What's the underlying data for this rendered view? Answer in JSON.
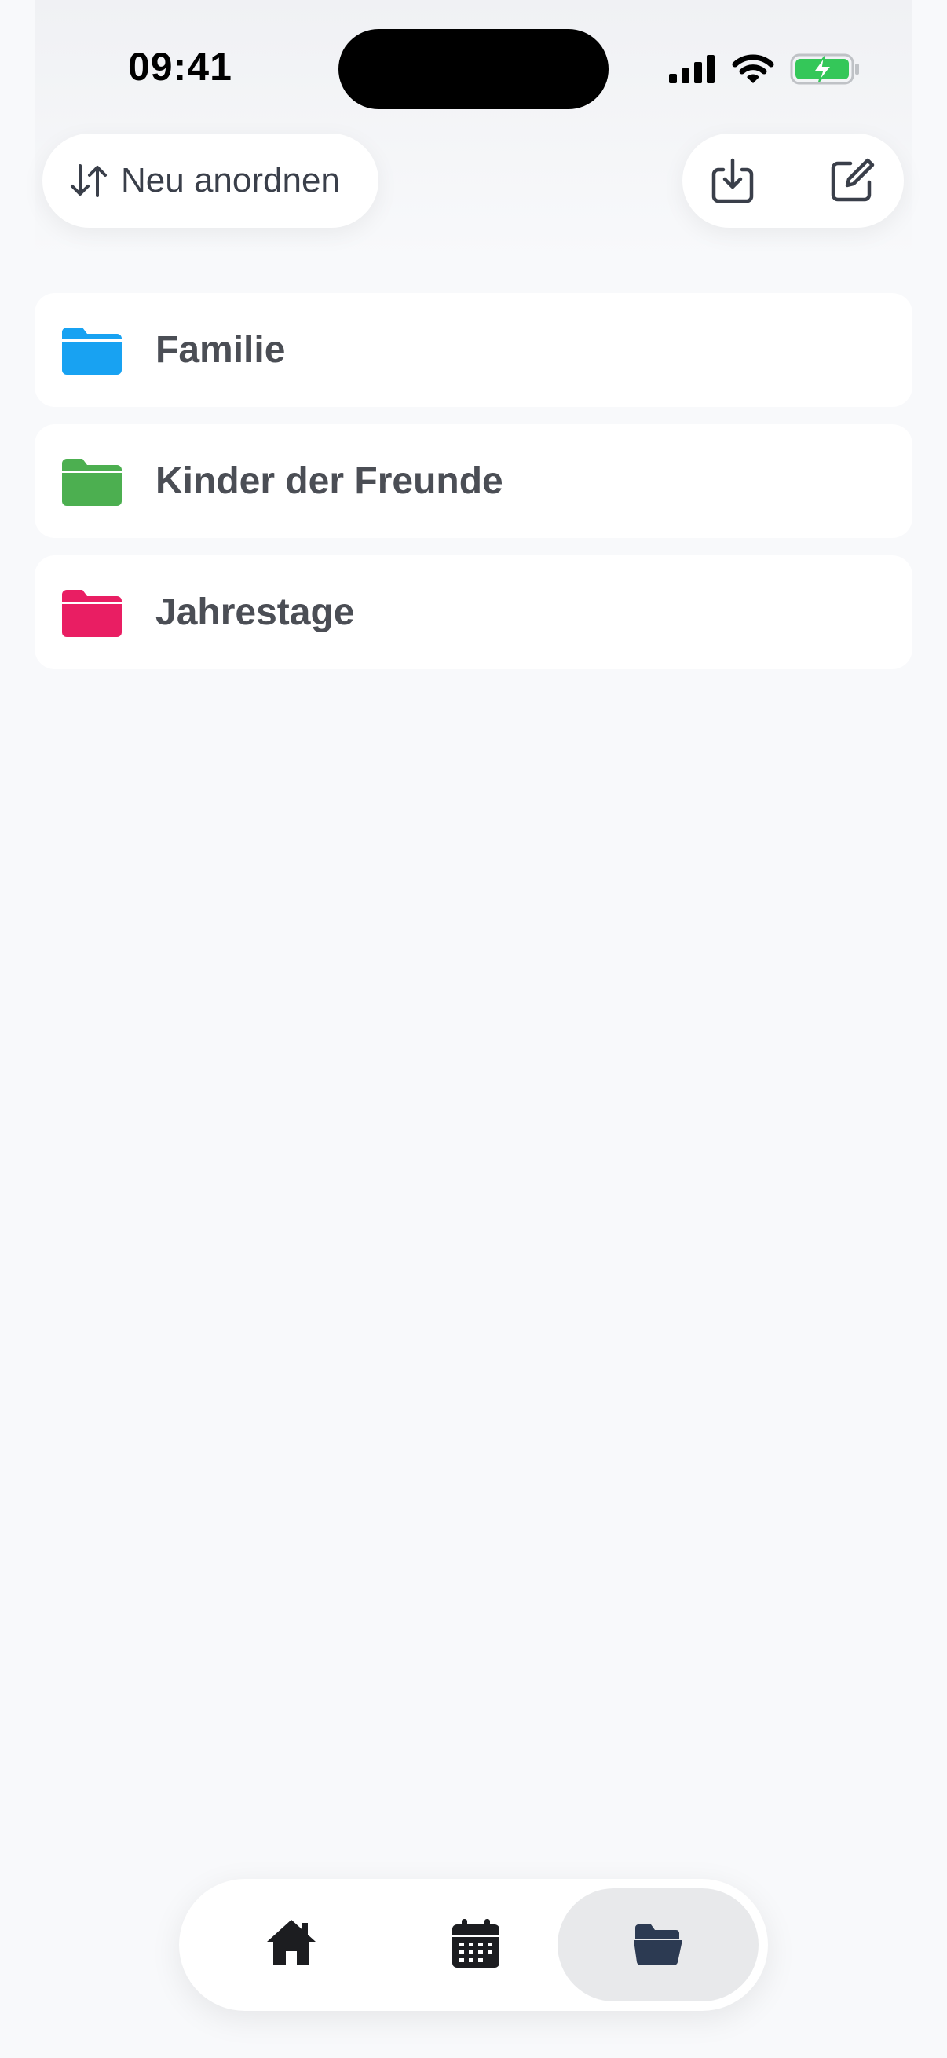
{
  "status_bar": {
    "time": "09:41"
  },
  "toolbar": {
    "reorder_label": "Neu anordnen",
    "reorder_icon": "sort-arrows-icon",
    "import_icon": "download-tray-icon",
    "compose_icon": "compose-icon"
  },
  "folders": [
    {
      "label": "Familie",
      "color": "#18a2f2",
      "icon": "folder-icon"
    },
    {
      "label": "Kinder der Freunde",
      "color": "#4caf50",
      "icon": "folder-icon"
    },
    {
      "label": "Jahrestage",
      "color": "#e91e63",
      "icon": "folder-icon"
    }
  ],
  "tabbar": {
    "tabs": [
      {
        "name": "home",
        "icon": "house-icon",
        "active": false
      },
      {
        "name": "calendar",
        "icon": "calendar-icon",
        "active": false
      },
      {
        "name": "folders",
        "icon": "open-folder-icon",
        "active": true
      }
    ],
    "active_color": "#2c3a52"
  }
}
